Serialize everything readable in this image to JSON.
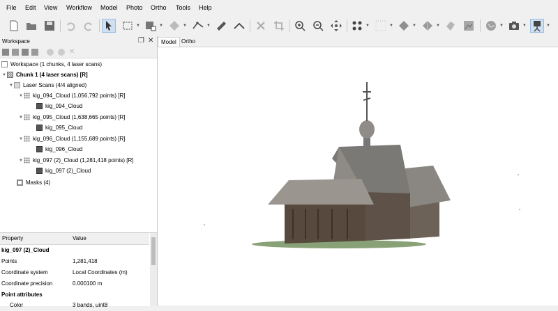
{
  "menu": [
    "File",
    "Edit",
    "View",
    "Workflow",
    "Model",
    "Photo",
    "Ortho",
    "Tools",
    "Help"
  ],
  "workspace": {
    "title": "Workspace",
    "root": "Workspace (1 chunks, 4 laser scans)",
    "chunk": "Chunk 1 (4 laser scans) [R]",
    "folder": "Laser Scans (4/4 aligned)",
    "scans": [
      {
        "cloud": "kig_094_Cloud (1,056,792 points) [R]",
        "image": "kig_094_Cloud"
      },
      {
        "cloud": "kig_095_Cloud (1,638,665 points) [R]",
        "image": "kig_095_Cloud"
      },
      {
        "cloud": "kig_096_Cloud (1,155,689 points) [R]",
        "image": "kig_096_Cloud"
      },
      {
        "cloud": "kig_097 (2)_Cloud (1,281,418 points) [R]",
        "image": "kig_097 (2)_Cloud"
      }
    ],
    "masks": "Masks (4)"
  },
  "properties": {
    "col_property": "Property",
    "col_value": "Value",
    "title": "kig_097 (2)_Cloud",
    "rows": [
      {
        "name": "Points",
        "value": "1,281,418"
      },
      {
        "name": "Coordinate system",
        "value": "Local Coordinates (m)"
      },
      {
        "name": "Coordinate precision",
        "value": "0.000100 m"
      }
    ],
    "section": "Point attributes",
    "color_name": "Color",
    "color_value": "3 bands, uint8"
  },
  "tabs": [
    "Model",
    "Ortho"
  ],
  "colors": {
    "accent": "#cfe0f3",
    "panel": "#f0f0f0"
  }
}
